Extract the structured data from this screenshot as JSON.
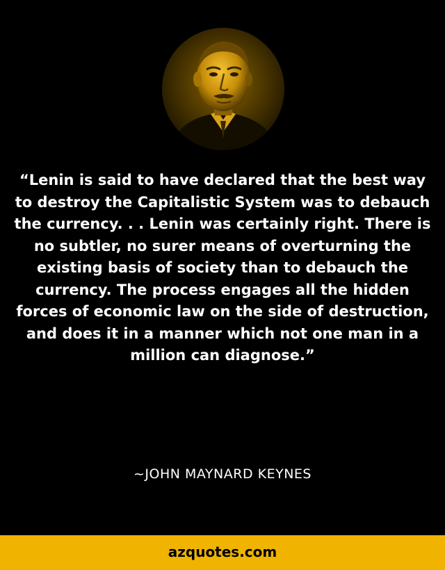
{
  "quote": {
    "text": "“Lenin is said to have declared that the best way to destroy the Capitalistic System was to debauch the currency. . . Lenin was certainly right. There is no subtler, no surer means of overturning the existing basis of society than to debauch the currency. The process engages all the hidden forces of economic law on the side of destruction, and does it in a manner which not one man in a million can diagnose.”"
  },
  "author": {
    "name": "~JOHN MAYNARD KEYNES"
  },
  "footer": {
    "site": "azquotes.com"
  },
  "colors": {
    "background": "#000000",
    "text": "#ffffff",
    "footer_bar": "#f0b400",
    "portrait_tint": "#e0a400"
  }
}
